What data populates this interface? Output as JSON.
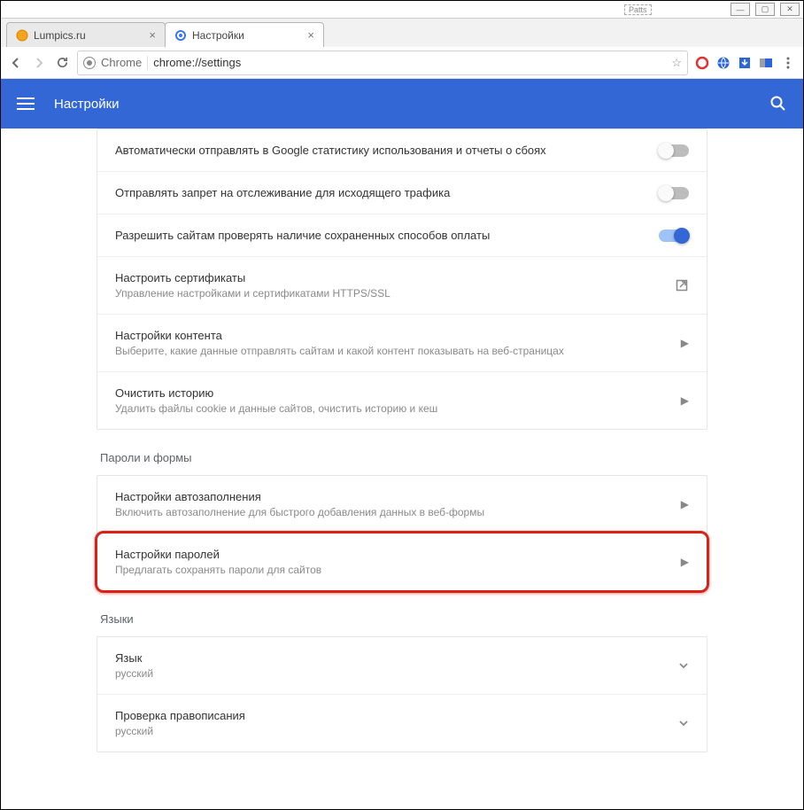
{
  "titlebar": {
    "app_hint": "Patts"
  },
  "tabs": [
    {
      "label": "Lumpics.ru",
      "active": false,
      "icon": "orange"
    },
    {
      "label": "Настройки",
      "active": true,
      "icon": "gear"
    }
  ],
  "addressbar": {
    "chrome_label": "Chrome",
    "url": "chrome://settings"
  },
  "banner": {
    "title": "Настройки"
  },
  "privacy": {
    "rows": [
      {
        "title": "Автоматически отправлять в Google статистику использования и отчеты о сбоях",
        "type": "toggle",
        "on": false
      },
      {
        "title": "Отправлять запрет на отслеживание для исходящего трафика",
        "type": "toggle",
        "on": false
      },
      {
        "title": "Разрешить сайтам проверять наличие сохраненных способов оплаты",
        "type": "toggle",
        "on": true
      },
      {
        "title": "Настроить сертификаты",
        "sub": "Управление настройками и сертификатами HTTPS/SSL",
        "type": "external"
      },
      {
        "title": "Настройки контента",
        "sub": "Выберите, какие данные отправлять сайтам и какой контент показывать на веб-страницах",
        "type": "arrow"
      },
      {
        "title": "Очистить историю",
        "sub": "Удалить файлы cookie и данные сайтов, очистить историю и кеш",
        "type": "arrow"
      }
    ]
  },
  "passwords": {
    "section": "Пароли и формы",
    "rows": [
      {
        "title": "Настройки автозаполнения",
        "sub": "Включить автозаполнение для быстрого добавления данных в веб-формы",
        "type": "arrow",
        "hl": false
      },
      {
        "title": "Настройки паролей",
        "sub": "Предлагать сохранять пароли для сайтов",
        "type": "arrow",
        "hl": true
      }
    ]
  },
  "languages": {
    "section": "Языки",
    "rows": [
      {
        "title": "Язык",
        "sub": "русский",
        "type": "chevron"
      },
      {
        "title": "Проверка правописания",
        "sub": "русский",
        "type": "chevron"
      }
    ]
  }
}
